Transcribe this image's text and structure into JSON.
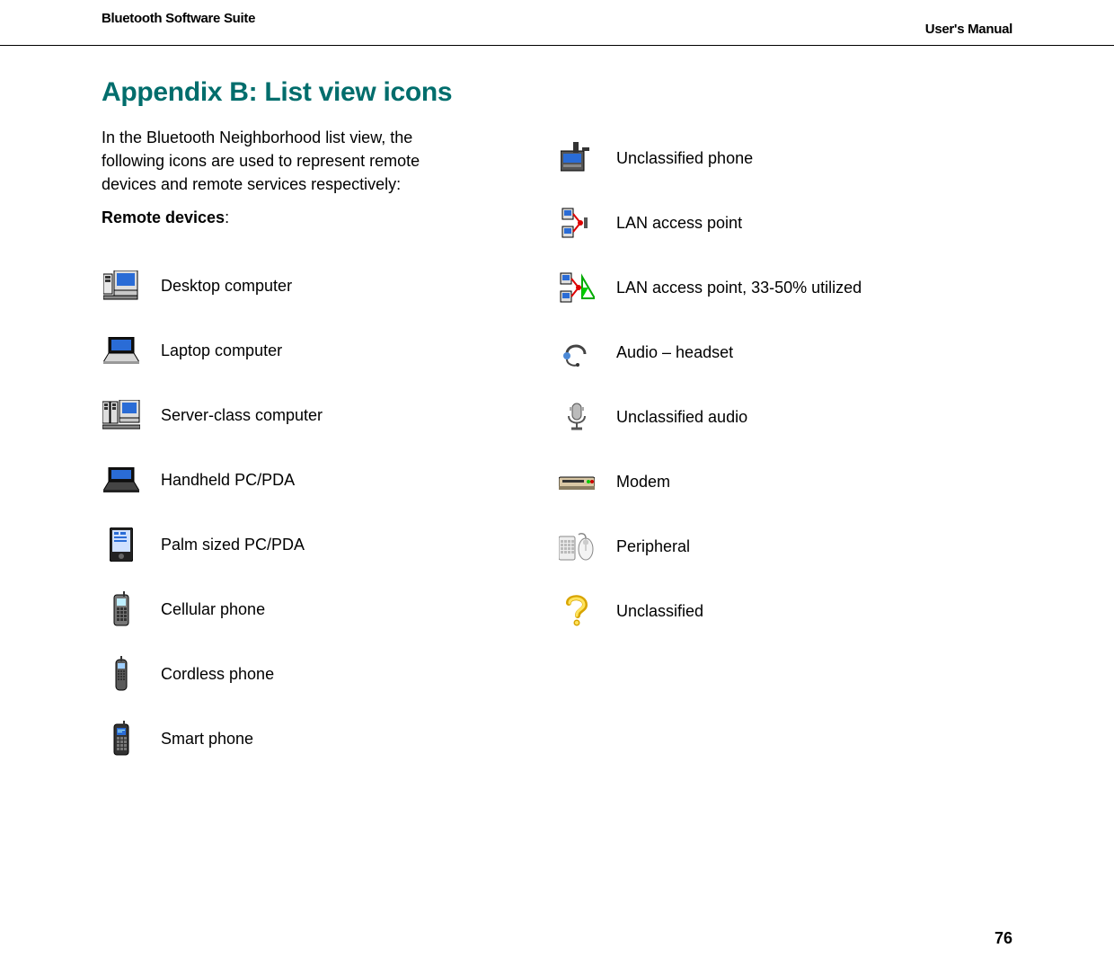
{
  "header": {
    "product": "Bluetooth Software Suite",
    "manual": "User's Manual"
  },
  "title": "Appendix B: List view icons",
  "intro": "In the Bluetooth Neighborhood list view, the following icons are used to represent remote devices and remote services respectively:",
  "subhead_label": "Remote devices",
  "subhead_suffix": ":",
  "left_items": [
    {
      "label": "Desktop computer"
    },
    {
      "label": "Laptop computer"
    },
    {
      "label": "Server-class computer"
    },
    {
      "label": "Handheld PC/PDA"
    },
    {
      "label": "Palm sized PC/PDA"
    },
    {
      "label": "Cellular phone"
    },
    {
      "label": "Cordless phone"
    },
    {
      "label": "Smart phone"
    }
  ],
  "right_items": [
    {
      "label": "Unclassified phone"
    },
    {
      "label": "LAN access point"
    },
    {
      "label": "LAN access point, 33-50% utilized"
    },
    {
      "label": "Audio – headset"
    },
    {
      "label": "Unclassified audio"
    },
    {
      "label": "Modem"
    },
    {
      "label": "Peripheral"
    },
    {
      "label": "Unclassified"
    }
  ],
  "page_number": "76"
}
